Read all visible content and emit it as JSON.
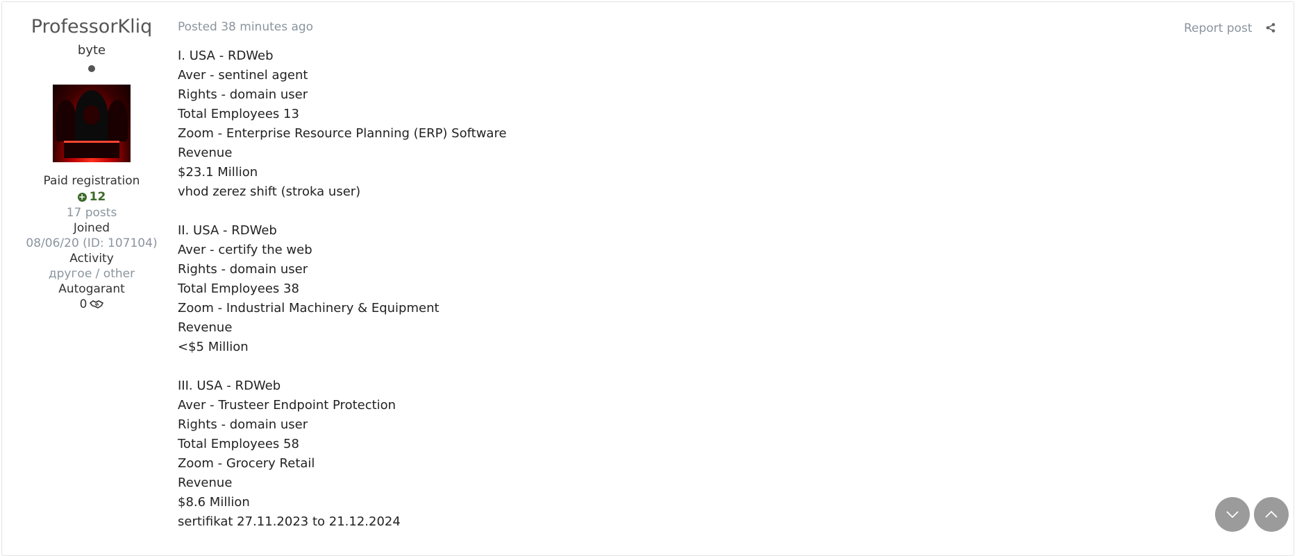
{
  "author": {
    "name": "ProfessorKliq",
    "rank": "byte",
    "group": "Paid registration",
    "reputation": "12",
    "posts": "17 posts",
    "joined_label": "Joined",
    "joined_value": "08/06/20 (ID: 107104)",
    "activity_label": "Activity",
    "activity_value": "другое / other",
    "autogarant_label": "Autogarant",
    "autogarant_value": "0"
  },
  "post": {
    "posted": "Posted 38 minutes ago",
    "report_label": "Report post",
    "lines": [
      "I. USA - RDWeb",
      "Aver - sentinel agent",
      "Rights - domain user",
      "Total Employees 13",
      "Zoom - Enterprise Resource Planning (ERP) Software",
      "Revenue",
      "$23.1 Million",
      "vhod zerez shift (stroka user)",
      "",
      "II. USA - RDWeb",
      "Aver - certify the web",
      "Rights - domain user",
      "Total Employees 38",
      "Zoom - Industrial Machinery & Equipment",
      "Revenue",
      "<$5 Million",
      "",
      "III. USA - RDWeb",
      "Aver - Trusteer Endpoint Protection",
      "Rights - domain user",
      "Total Employees 58",
      "Zoom - Grocery Retail",
      "Revenue",
      "$8.6 Million",
      "sertifikat 27.11.2023 to 21.12.2024"
    ]
  },
  "icons": {
    "plus": "+",
    "status": "online-status-dot",
    "share": "share-icon",
    "handshake": "handshake-icon",
    "scroll_down": "chevron-down-icon",
    "scroll_up": "chevron-up-icon"
  },
  "colors": {
    "reputation": "#3d6a2a",
    "muted": "#8a949e",
    "floating_button": "#9b9b9b"
  }
}
